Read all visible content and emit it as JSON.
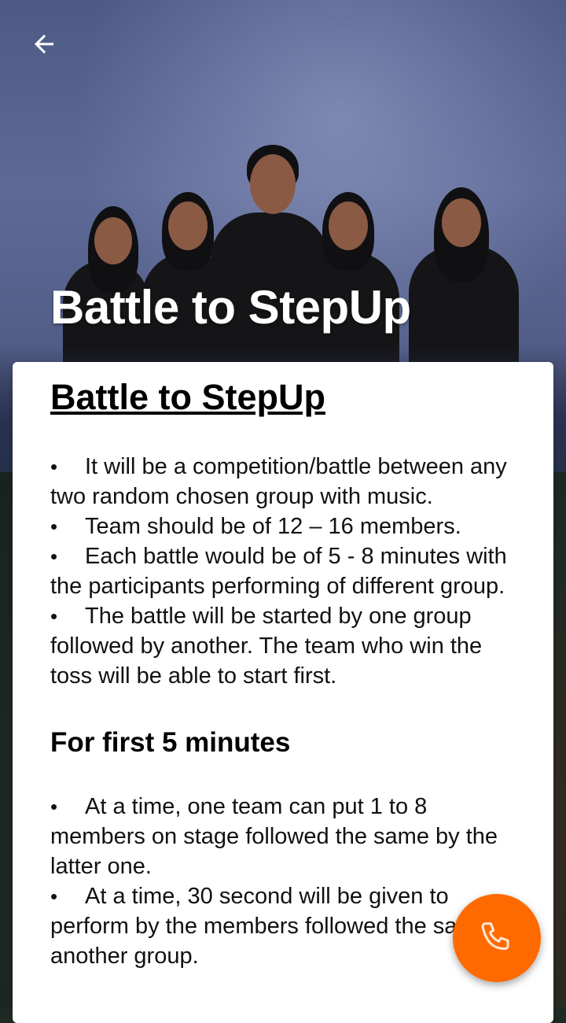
{
  "hero": {
    "title": "Battle to StepUp"
  },
  "content": {
    "heading": "Battle to StepUp",
    "intro_bullets": [
      "It will be a competition/battle between any two random chosen group with music.",
      "Team should be of 12 – 16 members.",
      "Each battle would be of 5 - 8 minutes with the participants performing of different group.",
      "The battle will be started by one group followed by another. The team who win the toss will be able to start first."
    ],
    "section_title": "For first 5 minutes",
    "section_bullets": [
      "At a time, one team can put 1 to 8 members on stage followed the same by the latter one.",
      "At a time, 30 second will be given to perform by the members followed the same by another group."
    ]
  },
  "icons": {
    "back": "back-arrow-icon",
    "call": "phone-icon"
  },
  "colors": {
    "fab": "#ff6a00",
    "card": "#ffffff",
    "title_text": "#ffffff"
  }
}
